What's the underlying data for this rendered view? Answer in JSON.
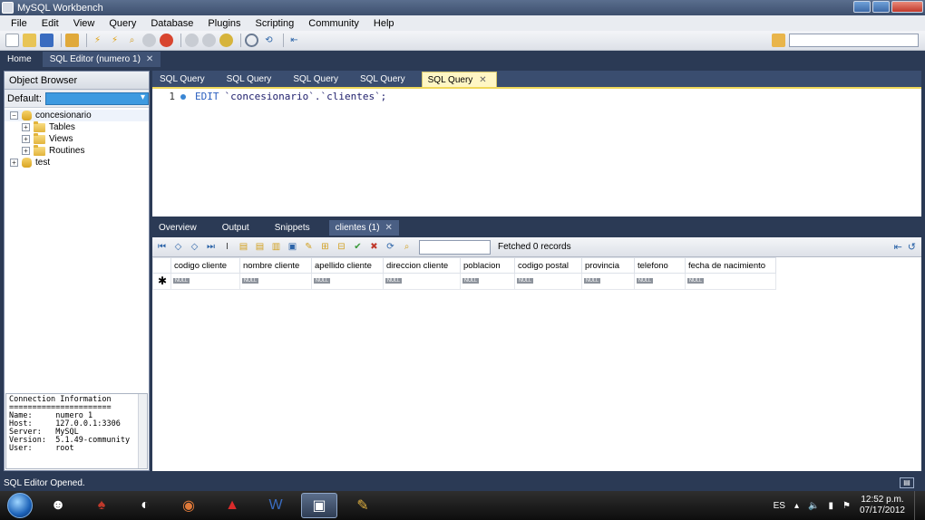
{
  "window": {
    "title": "MySQL Workbench"
  },
  "menu": [
    "File",
    "Edit",
    "View",
    "Query",
    "Database",
    "Plugins",
    "Scripting",
    "Community",
    "Help"
  ],
  "doc_tabs": {
    "home": "Home",
    "editor": "SQL Editor (numero 1)"
  },
  "object_browser": {
    "title": "Object Browser",
    "default_label": "Default:",
    "schemas": [
      {
        "name": "concesionario",
        "children": [
          "Tables",
          "Views",
          "Routines"
        ]
      },
      {
        "name": "test"
      }
    ]
  },
  "connection_info": {
    "title": "Connection Information",
    "separator": "======================",
    "rows": [
      {
        "key": "Name:",
        "value": "numero 1"
      },
      {
        "key": "Host:",
        "value": "127.0.0.1:3306"
      },
      {
        "key": "Server:",
        "value": "MySQL"
      },
      {
        "key": "Version:",
        "value": "5.1.49-community"
      },
      {
        "key": "User:",
        "value": "root"
      }
    ]
  },
  "query_tabs": [
    "SQL Query",
    "SQL Query",
    "SQL Query",
    "SQL Query",
    "SQL Query"
  ],
  "editor": {
    "line_number": "1",
    "keyword": "EDIT",
    "statement": "`concesionario`.`clientes`;"
  },
  "result_tabs": {
    "overview": "Overview",
    "output": "Output",
    "snippets": "Snippets",
    "active": "clientes (1)"
  },
  "result_toolbar": {
    "status": "Fetched 0 records"
  },
  "grid": {
    "columns": [
      "codigo cliente",
      "nombre cliente",
      "apellido cliente",
      "direccion cliente",
      "poblacion",
      "codigo postal",
      "provincia",
      "telefono",
      "fecha de nacimiento"
    ],
    "new_row_marker": "✱",
    "null_label": "NULL"
  },
  "status_bar": {
    "message": "SQL Editor Opened."
  },
  "taskbar": {
    "language": "ES",
    "time": "12:52 p.m.",
    "date": "07/17/2012"
  }
}
